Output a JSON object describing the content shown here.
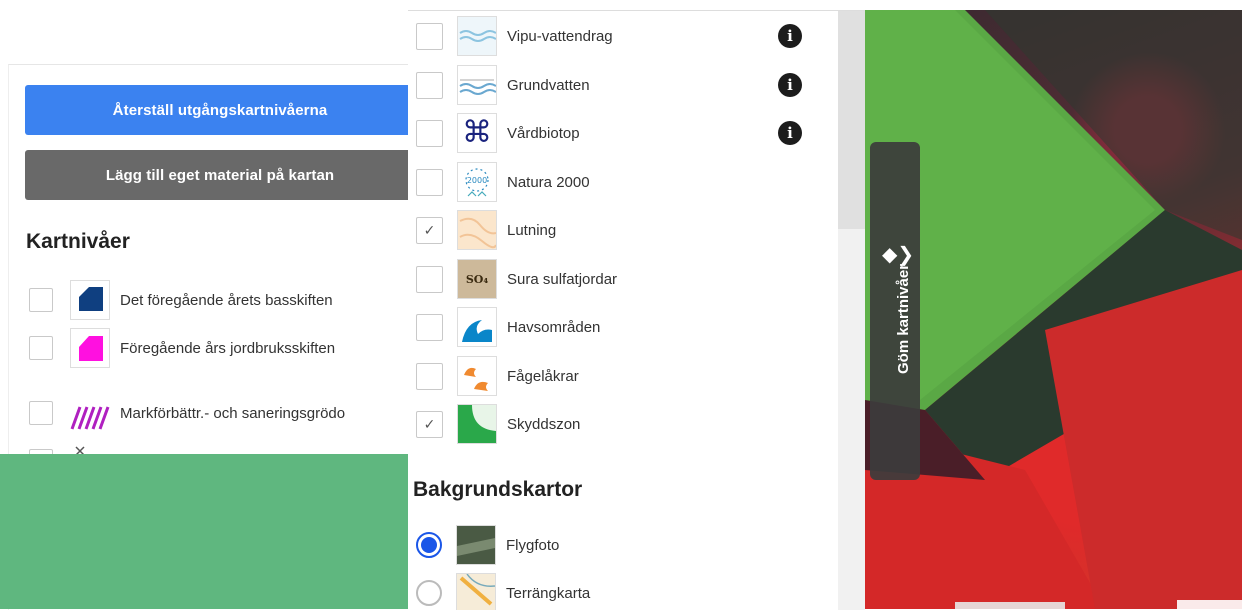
{
  "left_panel": {
    "reset_button": "Återställ utgångskartnivåerna",
    "add_material_button": "Lägg till eget material på kartan",
    "layers_title": "Kartnivåer",
    "layers": [
      {
        "label": "Det föregående årets basskiften",
        "checked": false,
        "icon": "blue-parcel-icon"
      },
      {
        "label": "Föregående års jordbruksskiften",
        "checked": false,
        "icon": "magenta-parcel-icon"
      },
      {
        "label": "Markförbättr.- och saneringsgrödo",
        "checked": false,
        "icon": "purple-hatch-icon"
      }
    ]
  },
  "center_panel": {
    "layers": [
      {
        "label": "Vipu-vattendrag",
        "checked": false,
        "info": true,
        "icon": "water-waves-icon"
      },
      {
        "label": "Grundvatten",
        "checked": false,
        "info": true,
        "icon": "groundwater-icon"
      },
      {
        "label": "Vårdbiotop",
        "checked": false,
        "info": true,
        "icon": "biotope-command-icon"
      },
      {
        "label": "Natura 2000",
        "checked": false,
        "info": false,
        "icon": "natura-2000-icon"
      },
      {
        "label": "Lutning",
        "checked": true,
        "info": false,
        "icon": "slope-map-icon"
      },
      {
        "label": "Sura sulfatjordar",
        "checked": false,
        "info": false,
        "icon": "sulfate-soil-icon"
      },
      {
        "label": "Havsområden",
        "checked": false,
        "info": false,
        "icon": "sea-wave-icon"
      },
      {
        "label": "Fågelåkrar",
        "checked": false,
        "info": false,
        "icon": "bird-fields-icon"
      },
      {
        "label": "Skyddszon",
        "checked": true,
        "info": false,
        "icon": "protection-zone-icon"
      }
    ],
    "natura_icon_text": "2000",
    "sulfate_icon_text": "SO₄",
    "background_title": "Bakgrundskartor",
    "backgrounds": [
      {
        "label": "Flygfoto",
        "selected": true,
        "icon": "aerial-photo-icon"
      },
      {
        "label": "Terrängkarta",
        "selected": false,
        "icon": "terrain-map-icon"
      }
    ]
  },
  "map": {
    "toggle_label": "Göm kartnivåer",
    "toggle_icon": "layers-icon",
    "toggle_glyph": "◆❯"
  },
  "colors": {
    "primary_button": "#3b82f0",
    "secondary_button": "#696969",
    "radio_selected": "#1a56e8",
    "overlay_green": "#5fb77f"
  }
}
